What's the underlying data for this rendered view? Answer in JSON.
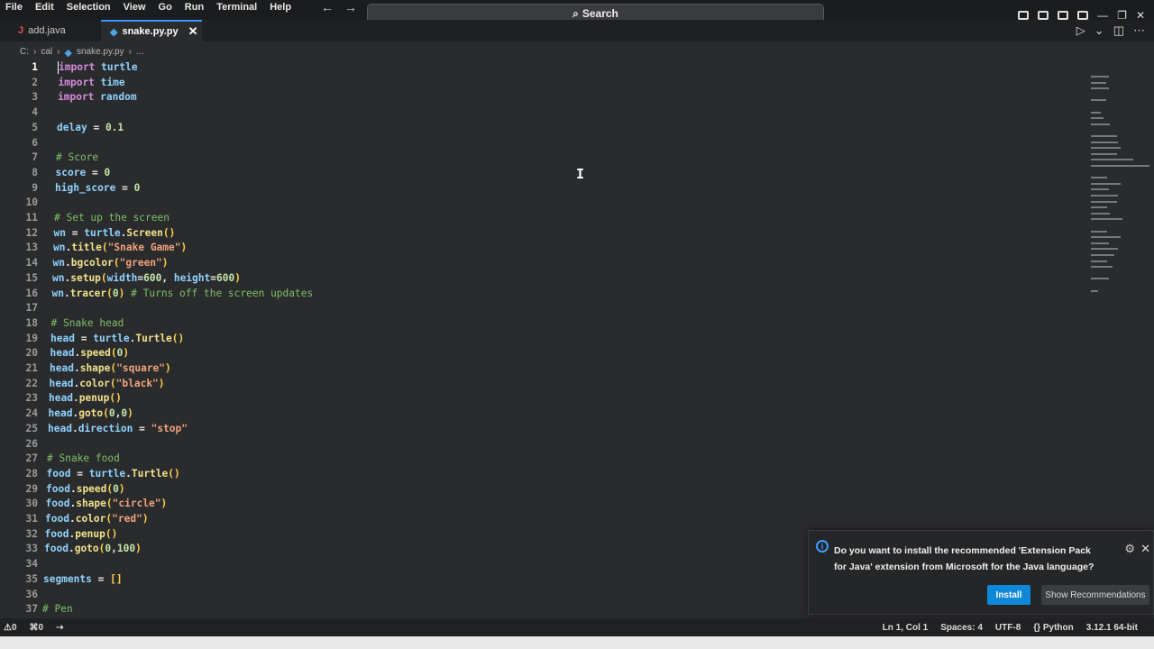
{
  "menu": [
    "File",
    "Edit",
    "Selection",
    "View",
    "Go",
    "Run",
    "Terminal",
    "Help"
  ],
  "search": {
    "label": "Search"
  },
  "tabs": [
    {
      "label": "add.java",
      "icon": "java-file-icon"
    },
    {
      "label": "snake.py.py",
      "icon": "python-file-icon",
      "active": true
    }
  ],
  "breadcrumb": [
    "C:",
    "cal",
    "snake.py.py",
    "..."
  ],
  "editor": {
    "lines": [
      {
        "n": "1",
        "text": "import turtle"
      },
      {
        "n": "2",
        "text": "import time"
      },
      {
        "n": "3",
        "text": "import random"
      },
      {
        "n": "4",
        "text": ""
      },
      {
        "n": "5",
        "text": "delay = 0.1"
      },
      {
        "n": "6",
        "text": ""
      },
      {
        "n": "7",
        "text": "# Score"
      },
      {
        "n": "8",
        "text": "score = 0"
      },
      {
        "n": "9",
        "text": "high_score = 0"
      },
      {
        "n": "10",
        "text": ""
      },
      {
        "n": "11",
        "text": "# Set up the screen"
      },
      {
        "n": "12",
        "text": "wn = turtle.Screen()"
      },
      {
        "n": "13",
        "text": "wn.title(\"Snake Game\")"
      },
      {
        "n": "14",
        "text": "wn.bgcolor(\"green\")"
      },
      {
        "n": "15",
        "text": "wn.setup(width=600, height=600)"
      },
      {
        "n": "16",
        "text": "wn.tracer(0) # Turns off the screen updates"
      },
      {
        "n": "17",
        "text": ""
      },
      {
        "n": "18",
        "text": "# Snake head"
      },
      {
        "n": "19",
        "text": "head = turtle.Turtle()"
      },
      {
        "n": "20",
        "text": "head.speed(0)"
      },
      {
        "n": "21",
        "text": "head.shape(\"square\")"
      },
      {
        "n": "22",
        "text": "head.color(\"black\")"
      },
      {
        "n": "23",
        "text": "head.penup()"
      },
      {
        "n": "24",
        "text": "head.goto(0,0)"
      },
      {
        "n": "25",
        "text": "head.direction = \"stop\""
      },
      {
        "n": "26",
        "text": ""
      },
      {
        "n": "27",
        "text": "# Snake food"
      },
      {
        "n": "28",
        "text": "food = turtle.Turtle()"
      },
      {
        "n": "29",
        "text": "food.speed(0)"
      },
      {
        "n": "30",
        "text": "food.shape(\"circle\")"
      },
      {
        "n": "31",
        "text": "food.color(\"red\")"
      },
      {
        "n": "32",
        "text": "food.penup()"
      },
      {
        "n": "33",
        "text": "food.goto(0,100)"
      },
      {
        "n": "34",
        "text": ""
      },
      {
        "n": "35",
        "text": "segments = []"
      },
      {
        "n": "36",
        "text": ""
      },
      {
        "n": "37",
        "text": "# Pen"
      }
    ]
  },
  "notification": {
    "message": "Do you want to install the recommended 'Extension Pack for Java' extension from Microsoft for the Java language?",
    "install_label": "Install",
    "show_label": "Show Recommendations"
  },
  "status": {
    "errors": "0",
    "warnings": "0",
    "position": "Ln 1, Col 1",
    "spaces": "Spaces: 4",
    "encoding": "UTF-8",
    "language": "Python",
    "interpreter": "3.12.1 64-bit"
  },
  "colors": {
    "accent": "#0e88d8",
    "background": "#2a2b2d"
  }
}
